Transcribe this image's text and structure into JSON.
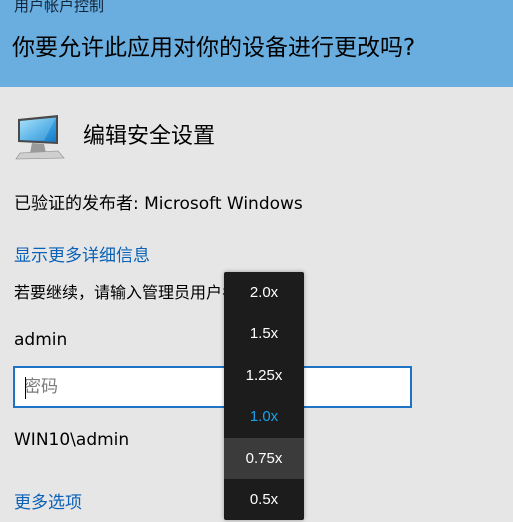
{
  "header": {
    "caption": "用户帐户控制",
    "question": "你要允许此应用对你的设备进行更改吗?"
  },
  "app": {
    "icon": "monitor-icon",
    "name": "编辑安全设置"
  },
  "publisher": {
    "text": "已验证的发布者: Microsoft Windows"
  },
  "details_link": "显示更多详细信息",
  "instruction": "若要继续，请输入管理员用户名和密码。",
  "username": "admin",
  "password": {
    "value": "",
    "placeholder": "密码"
  },
  "domain_user": "WIN10\\admin",
  "more_options": "更多选项",
  "speed_menu": {
    "items": [
      "2.0x",
      "1.5x",
      "1.25x",
      "1.0x",
      "0.75x",
      "0.5x"
    ],
    "selected": "1.0x",
    "highlighted": "0.75x"
  },
  "colors": {
    "header_bg": "#6aaee0",
    "content_bg": "#e6e6e6",
    "link": "#0a61b8",
    "input_border": "#1f73c4",
    "menu_bg": "#1c1c1c",
    "menu_selected": "#1aa0e8"
  }
}
